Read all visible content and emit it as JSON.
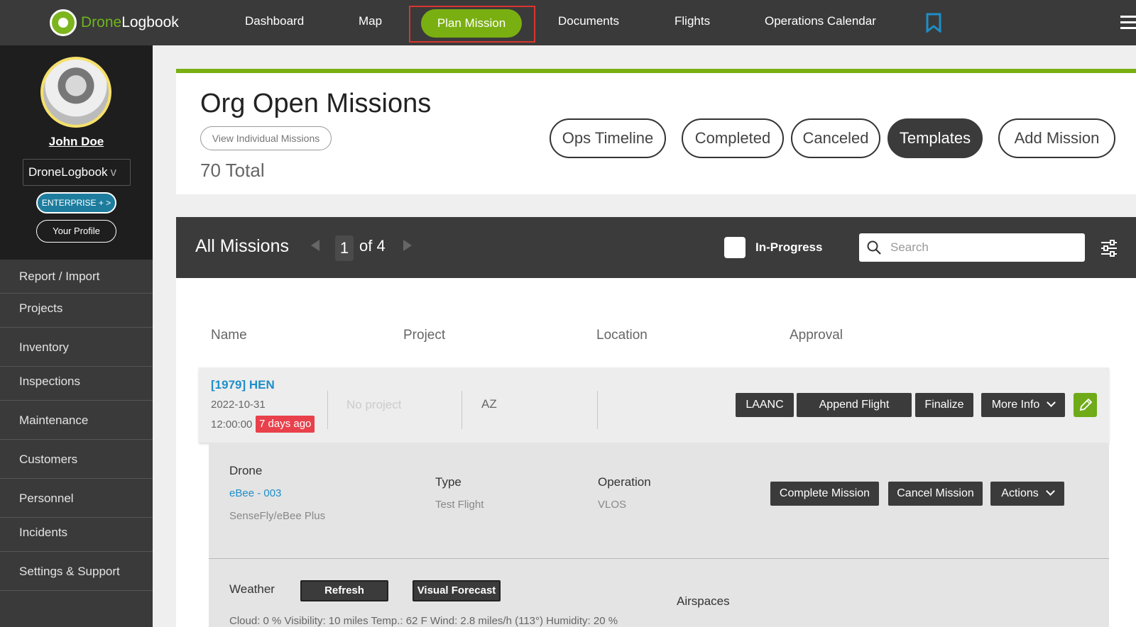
{
  "app": {
    "logo_brand": "Drone",
    "logo_suffix": "Logbook"
  },
  "nav": {
    "items": [
      "Dashboard",
      "Map",
      "Plan Mission",
      "Documents",
      "Flights",
      "Operations Calendar"
    ]
  },
  "colors": {
    "accent_green": "#7aaf12",
    "link_blue": "#1f8ec8",
    "badge_red": "#e8414b",
    "highlight_border": "#d9352e",
    "dark_bar": "#3b3b3b"
  },
  "profile": {
    "name": "John Doe",
    "org": "DroneLogbook",
    "org_chevron": "v",
    "plan": "ENTERPRISE + >",
    "profile_button": "Your Profile"
  },
  "sidebar": {
    "items": [
      "Report / Import",
      "Projects",
      "Inventory",
      "Inspections",
      "Maintenance",
      "Customers",
      "Personnel",
      "Incidents",
      "Settings & Support"
    ]
  },
  "header": {
    "title": "Org Open Missions",
    "view_individual": "View Individual Missions",
    "total": "70 Total",
    "buttons": [
      "Ops Timeline",
      "Completed",
      "Canceled",
      "Templates",
      "Add Mission"
    ]
  },
  "missions": {
    "title": "All Missions",
    "page": "1",
    "page_of": "of 4",
    "in_progress_label": "In-Progress",
    "in_progress_checked": false,
    "search_placeholder": "Search",
    "columns": [
      "Name",
      "Project",
      "Location",
      "Approval"
    ]
  },
  "mission_row": {
    "title": "[1979] HEN",
    "date": "2022-10-31",
    "time": "12:00:00",
    "relative": "7 days ago",
    "project": "No project",
    "location": "AZ",
    "actions": [
      "LAANC",
      "Append Flight",
      "Finalize",
      "More Info"
    ]
  },
  "detail": {
    "drone_label": "Drone",
    "drone_link": "eBee - 003",
    "drone_model": "SenseFly/eBee Plus",
    "type_label": "Type",
    "type_value": "Test Flight",
    "operation_label": "Operation",
    "operation_value": "VLOS",
    "buttons": [
      "Complete Mission",
      "Cancel Mission",
      "Actions"
    ],
    "weather_label": "Weather",
    "refresh": "Refresh",
    "visual_forecast": "Visual Forecast",
    "airspaces_label": "Airspaces",
    "weather_line": "Cloud: 0 %  Visibility: 10 miles  Temp.: 62 F  Wind: 2.8 miles/h (113°)  Humidity: 20 %"
  }
}
